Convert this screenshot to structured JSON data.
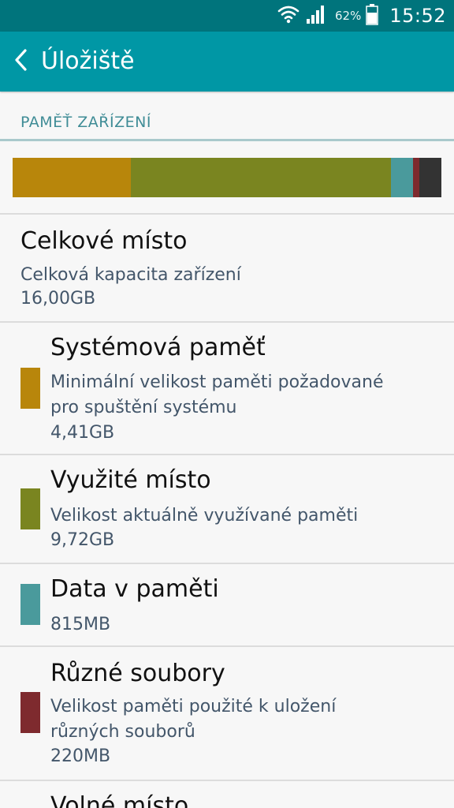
{
  "status_bar": {
    "battery_percent": "62%",
    "time": "15:52",
    "icons": [
      "wifi-icon",
      "signal-icon",
      "battery-icon"
    ]
  },
  "app_bar": {
    "back_icon": "chevron-left-icon",
    "title": "Úložiště"
  },
  "section": {
    "header": "PAMĚŤ ZAŘÍZENÍ"
  },
  "usage_bar": {
    "segments": [
      {
        "name": "system",
        "size_gb": 4.41,
        "color": "#b8860b"
      },
      {
        "name": "used",
        "size_gb": 9.72,
        "color": "#7a8520"
      },
      {
        "name": "cached",
        "size_gb": 0.815,
        "color": "#4a9a9c"
      },
      {
        "name": "misc",
        "size_gb": 0.22,
        "color": "#7e2a2e"
      },
      {
        "name": "free",
        "size_gb": 0.835,
        "color": "#333333"
      }
    ]
  },
  "total": {
    "title": "Celkové místo",
    "description": "Celková kapacita zařízení",
    "value": "16,00GB"
  },
  "items": [
    {
      "title": "Systémová paměť",
      "description_lines": [
        "Minimální velikost paměti požadované",
        "pro spuštění systému"
      ],
      "value": "4,41GB",
      "color": "#b8860b"
    },
    {
      "title": "Využité místo",
      "description_lines": [
        "Velikost aktuálně využívané paměti"
      ],
      "value": "9,72GB",
      "color": "#7a8520"
    },
    {
      "title": "Data v paměti",
      "description_lines": [],
      "value": "815MB",
      "color": "#4a9a9c"
    },
    {
      "title": "Různé soubory",
      "description_lines": [
        "Velikost paměti použité k uložení",
        "různých souborů"
      ],
      "value": "220MB",
      "color": "#7e2a2e"
    },
    {
      "title": "Volné místo"
    }
  ],
  "colors": {
    "status_bar": "#00747c",
    "app_bar": "#0097a5",
    "section_header": "#3f8c96",
    "secondary_text": "#43566a"
  }
}
